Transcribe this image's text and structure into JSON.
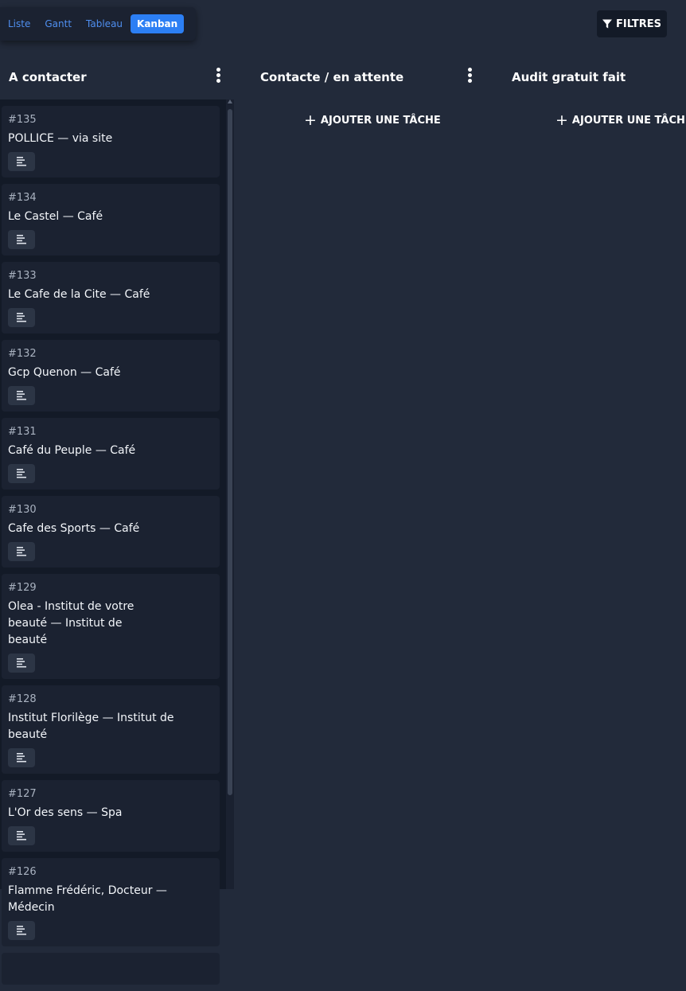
{
  "views": [
    "Liste",
    "Gantt",
    "Tableau",
    "Kanban"
  ],
  "active_view": "Kanban",
  "filters_label": "FILTRES",
  "columns": [
    {
      "title": "A contacter"
    },
    {
      "title": "Contacte / en attente",
      "add_label": "AJOUTER UNE TÂCHE"
    },
    {
      "title": "Audit gratuit fait",
      "add_label": "AJOUTER UNE TÂCHE"
    }
  ],
  "cards": [
    {
      "id": "#135",
      "title": "POLLICE — via site"
    },
    {
      "id": "#134",
      "title": "Le Castel — Café"
    },
    {
      "id": "#133",
      "title": "Le Cafe de la Cite — Café"
    },
    {
      "id": "#132",
      "title": "Gcp Quenon — Café"
    },
    {
      "id": "#131",
      "title": "Café du Peuple — Café"
    },
    {
      "id": "#130",
      "title": "Cafe des Sports — Café"
    },
    {
      "id": "#129",
      "title": "Olea - Institut de votre beauté — Institut de beauté"
    },
    {
      "id": "#128",
      "title": "Institut Florilège — Institut de beauté"
    },
    {
      "id": "#127",
      "title": "L'Or des sens — Spa"
    },
    {
      "id": "#126",
      "title": "Flamme Frédéric, Docteur — Médecin"
    }
  ]
}
